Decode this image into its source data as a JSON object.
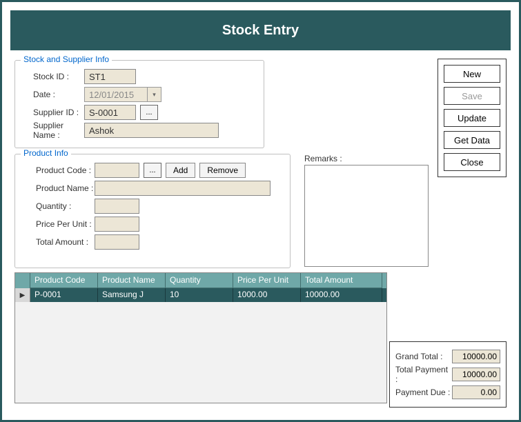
{
  "title": "Stock Entry",
  "stock_supplier": {
    "legend": "Stock and Supplier Info",
    "stock_id_label": "Stock ID :",
    "stock_id": "ST1",
    "date_label": "Date :",
    "date": "12/01/2015",
    "supplier_id_label": "Supplier ID :",
    "supplier_id": "S-0001",
    "browse": "...",
    "supplier_name_label": "Supplier Name :",
    "supplier_name": "Ashok"
  },
  "product": {
    "legend": "Product Info",
    "code_label": "Product Code :",
    "code": "",
    "browse": "...",
    "add_label": "Add",
    "remove_label": "Remove",
    "name_label": "Product Name :",
    "name": "",
    "qty_label": "Quantity :",
    "qty": "",
    "price_label": "Price Per Unit :",
    "price": "",
    "total_label": "Total Amount :",
    "total": ""
  },
  "remarks": {
    "label": "Remarks :",
    "value": ""
  },
  "actions": {
    "new": "New",
    "save": "Save",
    "update": "Update",
    "get_data": "Get Data",
    "close": "Close"
  },
  "grid": {
    "headers": {
      "code": "Product Code",
      "name": "Product Name",
      "qty": "Quantity",
      "price": "Price Per Unit",
      "total": "Total Amount"
    },
    "row0": {
      "code": "P-0001",
      "name": "Samsung J",
      "qty": "10",
      "price": "1000.00",
      "total": "10000.00"
    }
  },
  "totals": {
    "grand_label": "Grand Total :",
    "grand": "10000.00",
    "payment_label": "Total Payment :",
    "payment": "10000.00",
    "due_label": "Payment Due :",
    "due": "0.00"
  }
}
